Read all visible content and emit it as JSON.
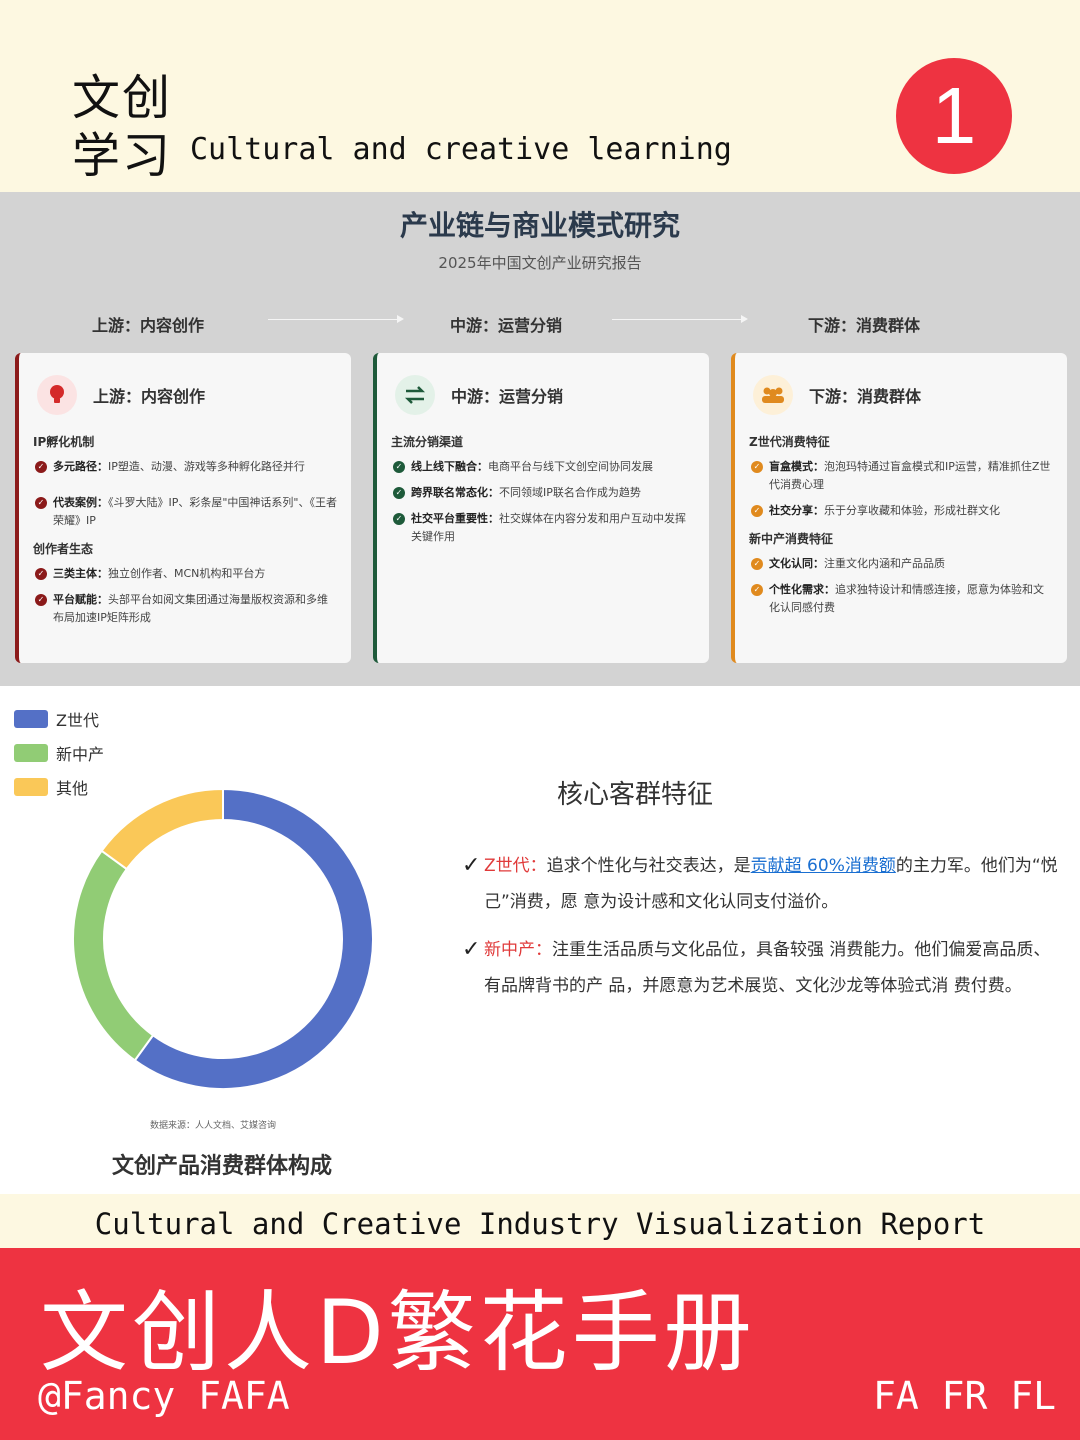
{
  "header": {
    "title_line1": "文创",
    "title_line2": "学习",
    "subtitle_en": "Cultural and creative learning",
    "badge_number": "1"
  },
  "report": {
    "title": "产业链与商业模式研究",
    "subtitle": "2025年中国文创产业研究报告",
    "stages": [
      "上游：内容创作",
      "中游：运营分销",
      "下游：消费群体"
    ],
    "cards": [
      {
        "heading": "上游：内容创作",
        "icon": "lightbulb-icon",
        "accent": "#8b1a1a",
        "sections": [
          {
            "title": "IP孵化机制",
            "items": [
              {
                "key": "多元路径：",
                "text": "IP塑造、动漫、游戏等多种孵化路径并行"
              },
              {
                "key": "代表案例：",
                "text": "《斗罗大陆》IP、彩条屋\"中国神话系列\"、《王者荣耀》IP"
              }
            ]
          },
          {
            "title": "创作者生态",
            "items": [
              {
                "key": "三类主体：",
                "text": "独立创作者、MCN机构和平台方"
              },
              {
                "key": "平台赋能：",
                "text": "头部平台如阅文集团通过海量版权资源和多维布局加速IP矩阵形成"
              }
            ]
          }
        ]
      },
      {
        "heading": "中游：运营分销",
        "icon": "exchange-arrows-icon",
        "accent": "#1e5a3a",
        "sections": [
          {
            "title": "主流分销渠道",
            "items": [
              {
                "key": "线上线下融合：",
                "text": "电商平台与线下文创空间协同发展"
              },
              {
                "key": "跨界联名常态化：",
                "text": "不同领域IP联名合作成为趋势"
              },
              {
                "key": "社交平台重要性：",
                "text": "社交媒体在内容分发和用户互动中发挥关键作用"
              }
            ]
          }
        ]
      },
      {
        "heading": "下游：消费群体",
        "icon": "users-icon",
        "accent": "#e08a1e",
        "sections": [
          {
            "title": "Z世代消费特征",
            "items": [
              {
                "key": "盲盒模式：",
                "text": "泡泡玛特通过盲盒模式和IP运营，精准抓住Z世代消费心理"
              },
              {
                "key": "社交分享：",
                "text": "乐于分享收藏和体验，形成社群文化"
              }
            ]
          },
          {
            "title": "新中产消费特征",
            "items": [
              {
                "key": "文化认同：",
                "text": "注重文化内涵和产品品质"
              },
              {
                "key": "个性化需求：",
                "text": "追求独特设计和情感连接，愿意为体验和文化认同感付费"
              }
            ]
          }
        ]
      }
    ]
  },
  "customers": {
    "core_title": "核心客群特征",
    "features": [
      {
        "label": "Z世代：",
        "text_before": "追求个性化与社交表达，是",
        "link": "贡献超 60%消费额",
        "text_after": "的主力军。他们为“悦己”消费，愿 意为设计感和文化认同支付溢价。"
      },
      {
        "label": "新中产：",
        "text_before": "注重生活品质与文化品位，具备较强 消费能力。他们偏爱高品质、有品牌背书的产 品，并愿意为艺术展览、文化沙龙等体验式消 费付费。",
        "link": "",
        "text_after": ""
      }
    ],
    "source_note": "数据来源：人人文档、艾媒咨询",
    "chart_caption": "文创产品消费群体构成"
  },
  "chart_data": {
    "type": "pie",
    "title": "文创产品消费群体构成",
    "labels": [
      "Z世代",
      "新中产",
      "其他"
    ],
    "values": [
      60,
      25,
      15
    ],
    "colors": [
      "#5470c6",
      "#91cc75",
      "#fac858"
    ],
    "donut": true,
    "legend": "top-left"
  },
  "footer": {
    "report_en": "Cultural and Creative Industry Visualization Report",
    "brand_cn": "文创人D繁花手册",
    "handle": "@Fancy FAFA",
    "tags": "FA FR FL"
  }
}
